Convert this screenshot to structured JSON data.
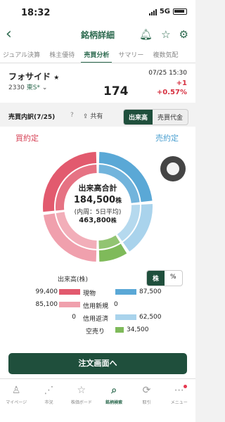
{
  "status": {
    "time": "18:32",
    "network": "5G"
  },
  "nav": {
    "title": "銘柄詳細",
    "back": "‹"
  },
  "tabs": [
    "ジュアル決算",
    "株主優待",
    "売買分析",
    "サマリー",
    "複数気配"
  ],
  "stock": {
    "name": "フォサイド",
    "star": "★",
    "code": "2330",
    "market": "東S*",
    "caret": "⌄",
    "datetime": "07/25 15:30",
    "price": "174",
    "change": "+1",
    "change_pct": "+0.57%"
  },
  "breakdown": {
    "label": "売買内訳(7/25)",
    "help": "?",
    "share": "共有",
    "seg_volume": "出来高",
    "seg_value": "売買代金"
  },
  "chart": {
    "buy_label": "買約定",
    "sell_label": "売約定",
    "center_title": "出来高合計",
    "total": "184,500",
    "total_unit": "株",
    "weekly_label": "(内周：5日平均)",
    "weekly": "463,800",
    "weekly_unit": "株",
    "unit_label": "出来高(株)",
    "unit_shares": "株",
    "unit_pct": "%"
  },
  "colors": {
    "buy_spot": "#e25a6e",
    "buy_margin": "#f0a0ad",
    "sell_spot": "#5aa8d6",
    "sell_margin_return": "#a9d3ec",
    "short": "#7fba5a"
  },
  "chart_data": {
    "type": "pie",
    "outer": [
      {
        "name": "現物(買)",
        "value": 99400
      },
      {
        "name": "信用新規(買)",
        "value": 85100
      },
      {
        "name": "空売り",
        "value": 34500
      },
      {
        "name": "信用返済(売)",
        "value": 62500
      },
      {
        "name": "現物(売)",
        "value": 87500
      }
    ]
  },
  "rows": [
    {
      "left": "99,400",
      "cat": "現物",
      "right": "87,500"
    },
    {
      "left": "85,100",
      "cat": "信用新規",
      "right": "0"
    },
    {
      "left": "0",
      "cat": "信用返済",
      "right": "62,500"
    },
    {
      "left": "",
      "cat": "空売り",
      "right": "34,500"
    }
  ],
  "order_button": "注文画面へ",
  "bottom_nav": [
    {
      "icon": "person-icon",
      "glyph": "♙",
      "label": "マイページ"
    },
    {
      "icon": "market-icon",
      "glyph": "⋰",
      "label": "市況"
    },
    {
      "icon": "star-board-icon",
      "glyph": "☆",
      "label": "株価ボード"
    },
    {
      "icon": "search-icon",
      "glyph": "⌕",
      "label": "銘柄検索"
    },
    {
      "icon": "trade-icon",
      "glyph": "⟳",
      "label": "取引"
    },
    {
      "icon": "menu-icon",
      "glyph": "⋯",
      "label": "メニュー"
    }
  ]
}
